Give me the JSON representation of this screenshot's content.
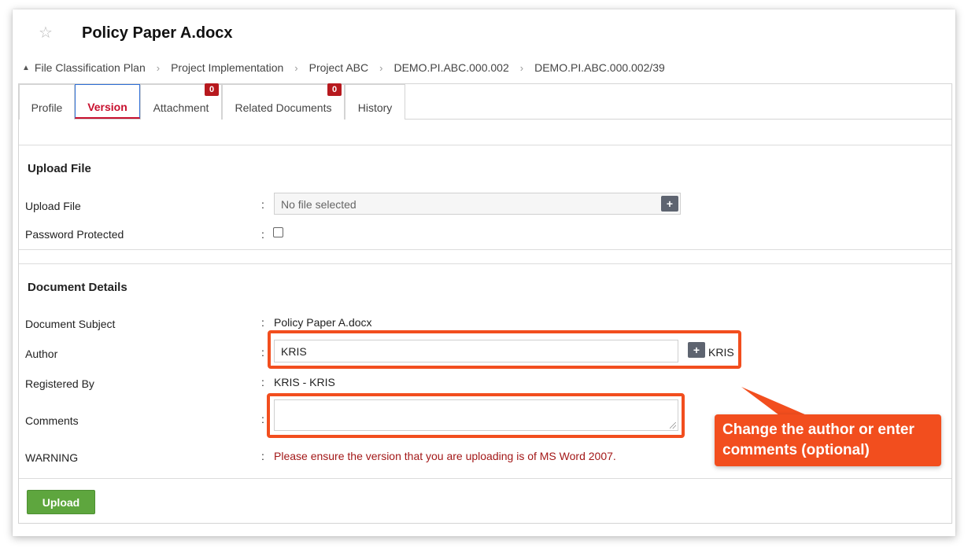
{
  "document": {
    "title": "Policy Paper A.docx"
  },
  "breadcrumb": [
    "File Classification Plan",
    "Project Implementation",
    "Project ABC",
    "DEMO.PI.ABC.000.002",
    "DEMO.PI.ABC.000.002/39"
  ],
  "tabs": [
    {
      "label": "Profile",
      "active": false
    },
    {
      "label": "Version",
      "active": true
    },
    {
      "label": "Attachment",
      "badge": "0"
    },
    {
      "label": "Related Documents",
      "badge": "0"
    },
    {
      "label": "History"
    }
  ],
  "upload_section": {
    "title": "Upload File",
    "upload_file_label": "Upload File",
    "file_placeholder": "No file selected",
    "password_label": "Password Protected",
    "password_checked": false
  },
  "details_section": {
    "title": "Document Details",
    "subject_label": "Document Subject",
    "subject_value": "Policy Paper A.docx",
    "author_label": "Author",
    "author_value": "KRIS",
    "author_display": "KRIS",
    "registered_label": "Registered By",
    "registered_value": "KRIS - KRIS",
    "comments_label": "Comments",
    "comments_value": "",
    "warning_label": "WARNING",
    "warning_text": "Please ensure the version that you are uploading is of MS Word 2007."
  },
  "colon": ":",
  "buttons": {
    "upload": "Upload",
    "plus": "+"
  },
  "callout": {
    "text": "Change the author or enter comments (optional)"
  },
  "colors": {
    "accent_red": "#c8102e",
    "badge_red": "#b7191e",
    "annotation_orange": "#f24e1e",
    "upload_green": "#5ea63e",
    "warning_red": "#a31818"
  }
}
